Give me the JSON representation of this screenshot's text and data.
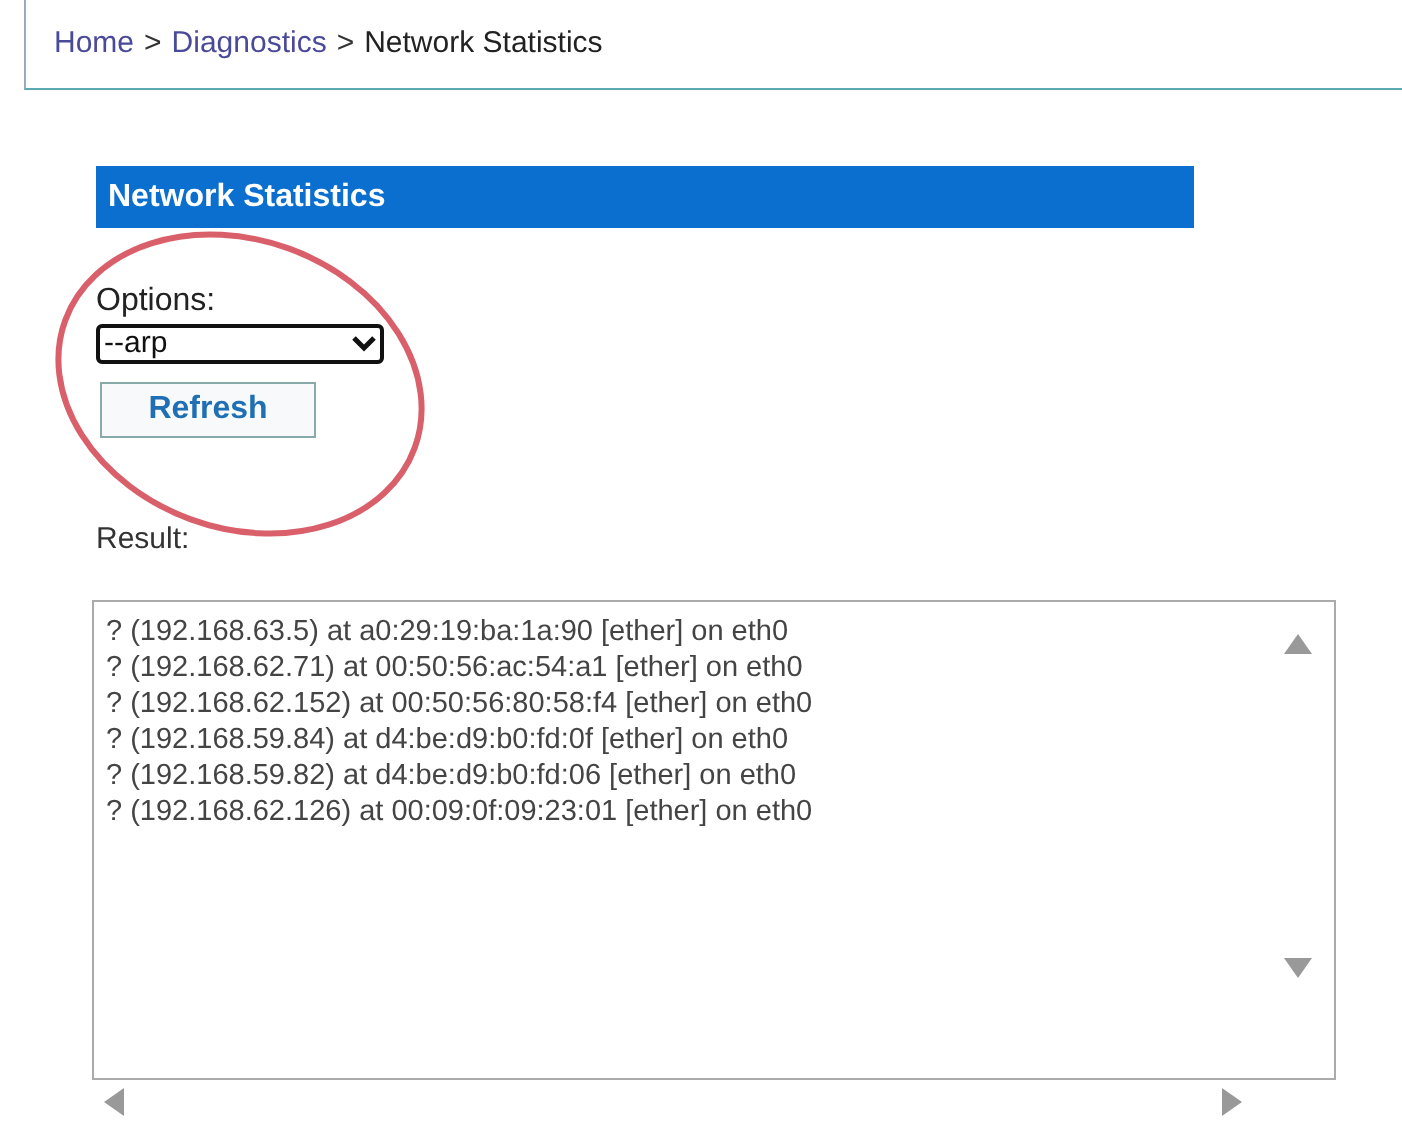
{
  "breadcrumb": [
    {
      "kind": "link",
      "text": "Home"
    },
    {
      "kind": "separator",
      "text": ">"
    },
    {
      "kind": "link",
      "text": "Diagnostics"
    },
    {
      "kind": "separator",
      "text": ">"
    },
    {
      "kind": "current",
      "text": "Network Statistics"
    }
  ],
  "panel": {
    "title": "Network Statistics",
    "options_label": "Options:",
    "options_value": "--arp",
    "refresh_button": "Refresh"
  },
  "result": {
    "label": "Result:",
    "lines": [
      "? (192.168.63.5) at a0:29:19:ba:1a:90 [ether] on eth0",
      "? (192.168.62.71) at 00:50:56:ac:54:a1 [ether] on eth0",
      "? (192.168.62.152) at 00:50:56:80:58:f4 [ether] on eth0",
      "? (192.168.59.84) at d4:be:d9:b0:fd:0f [ether] on eth0",
      "? (192.168.59.82) at d4:be:d9:b0:fd:06 [ether] on eth0",
      "? (192.168.62.126) at 00:09:0f:09:23:01 [ether] on eth0"
    ]
  }
}
